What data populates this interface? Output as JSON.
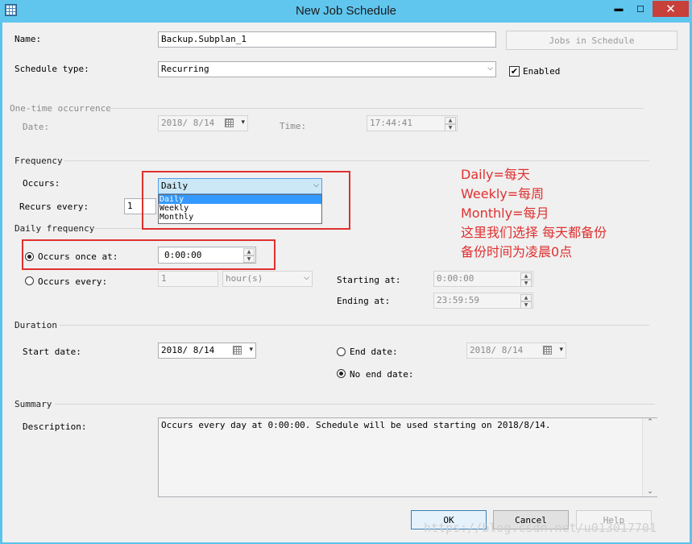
{
  "window": {
    "title": "New Job Schedule",
    "minimize": "▬",
    "maximize": "☐",
    "close": "✕"
  },
  "name": {
    "label": "Name:",
    "value": "Backup.Subplan_1"
  },
  "jobs_in_schedule": "Jobs in Schedule",
  "schedule_type": {
    "label": "Schedule type:",
    "value": "Recurring"
  },
  "enabled": {
    "label": "Enabled",
    "checked": true
  },
  "one_time": {
    "group": "One-time occurrence",
    "date_label": "Date:",
    "date_value": "2018/ 8/14",
    "time_label": "Time:",
    "time_value": "17:44:41"
  },
  "frequency": {
    "group": "Frequency",
    "occurs_label": "Occurs:",
    "occurs_value": "Daily",
    "options": [
      "Daily",
      "Weekly",
      "Monthly"
    ],
    "recurs_label": "Recurs every:",
    "recurs_value": "1"
  },
  "daily_frequency": {
    "group": "Daily frequency",
    "once_label": "Occurs once at:",
    "once_value": "0:00:00",
    "every_label": "Occurs every:",
    "every_value": "1",
    "every_unit": "hour(s)",
    "starting_label": "Starting at:",
    "starting_value": "0:00:00",
    "ending_label": "Ending at:",
    "ending_value": "23:59:59"
  },
  "duration": {
    "group": "Duration",
    "start_label": "Start date:",
    "start_value": "2018/ 8/14",
    "end_label": "End date:",
    "end_value": "2018/ 8/14",
    "no_end_label": "No end date:"
  },
  "summary": {
    "group": "Summary",
    "desc_label": "Description:",
    "desc_value": "Occurs every day at 0:00:00. Schedule will be used starting on 2018/8/14."
  },
  "buttons": {
    "ok": "OK",
    "cancel": "Cancel",
    "help": "Help"
  },
  "annotation": {
    "line1": "Daily=每天",
    "line2": "Weekly=每周",
    "line3": "Monthly=每月",
    "line4": "这里我们选择 每天都备份",
    "line5": "备份时间为凌晨0点"
  },
  "watermark": "https://blog.csdn.net/u013017701",
  "colors": {
    "annotation": "#e03030",
    "selection": "#3399ff",
    "titlebar": "#60c6ee"
  }
}
